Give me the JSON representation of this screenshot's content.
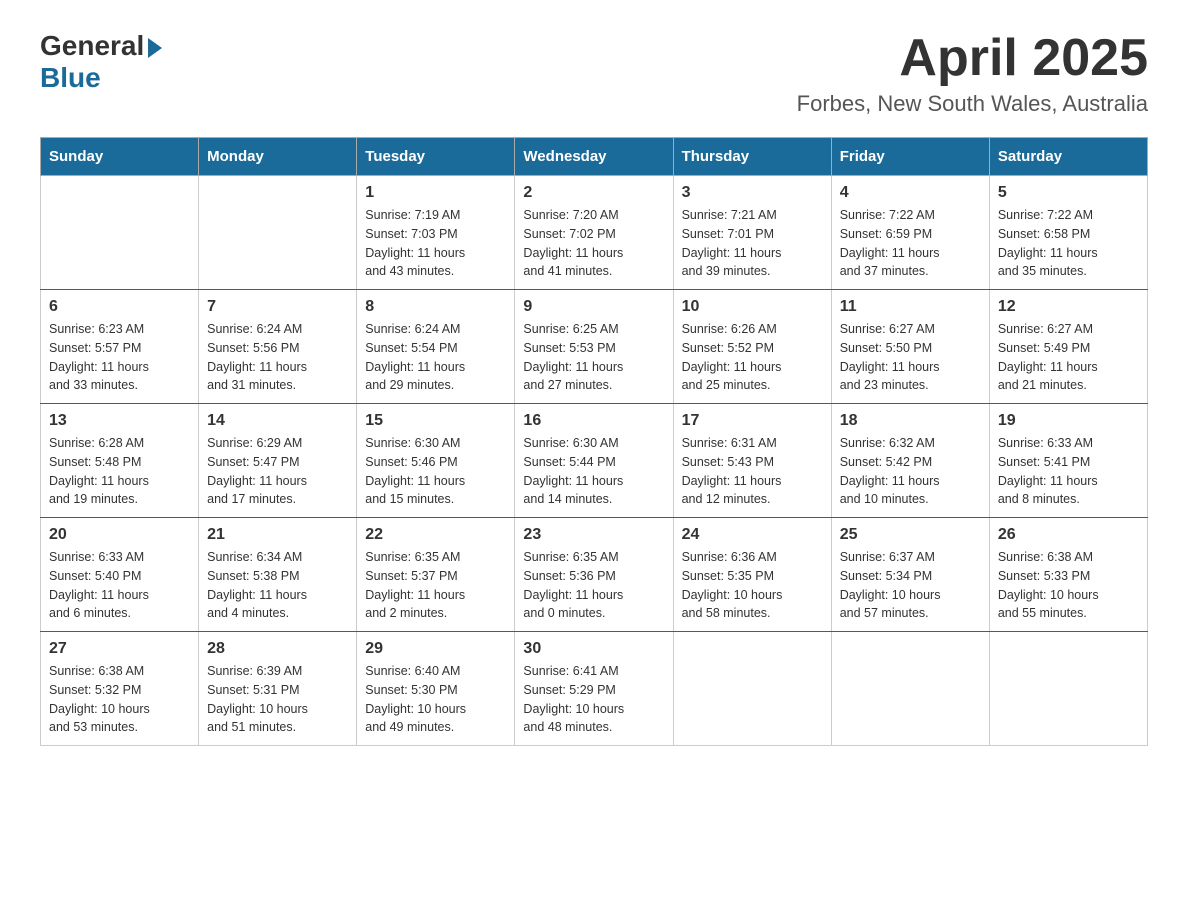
{
  "header": {
    "logo_general": "General",
    "logo_blue": "Blue",
    "title": "April 2025",
    "subtitle": "Forbes, New South Wales, Australia"
  },
  "weekdays": [
    "Sunday",
    "Monday",
    "Tuesday",
    "Wednesday",
    "Thursday",
    "Friday",
    "Saturday"
  ],
  "weeks": [
    [
      {
        "day": "",
        "info": ""
      },
      {
        "day": "",
        "info": ""
      },
      {
        "day": "1",
        "info": "Sunrise: 7:19 AM\nSunset: 7:03 PM\nDaylight: 11 hours\nand 43 minutes."
      },
      {
        "day": "2",
        "info": "Sunrise: 7:20 AM\nSunset: 7:02 PM\nDaylight: 11 hours\nand 41 minutes."
      },
      {
        "day": "3",
        "info": "Sunrise: 7:21 AM\nSunset: 7:01 PM\nDaylight: 11 hours\nand 39 minutes."
      },
      {
        "day": "4",
        "info": "Sunrise: 7:22 AM\nSunset: 6:59 PM\nDaylight: 11 hours\nand 37 minutes."
      },
      {
        "day": "5",
        "info": "Sunrise: 7:22 AM\nSunset: 6:58 PM\nDaylight: 11 hours\nand 35 minutes."
      }
    ],
    [
      {
        "day": "6",
        "info": "Sunrise: 6:23 AM\nSunset: 5:57 PM\nDaylight: 11 hours\nand 33 minutes."
      },
      {
        "day": "7",
        "info": "Sunrise: 6:24 AM\nSunset: 5:56 PM\nDaylight: 11 hours\nand 31 minutes."
      },
      {
        "day": "8",
        "info": "Sunrise: 6:24 AM\nSunset: 5:54 PM\nDaylight: 11 hours\nand 29 minutes."
      },
      {
        "day": "9",
        "info": "Sunrise: 6:25 AM\nSunset: 5:53 PM\nDaylight: 11 hours\nand 27 minutes."
      },
      {
        "day": "10",
        "info": "Sunrise: 6:26 AM\nSunset: 5:52 PM\nDaylight: 11 hours\nand 25 minutes."
      },
      {
        "day": "11",
        "info": "Sunrise: 6:27 AM\nSunset: 5:50 PM\nDaylight: 11 hours\nand 23 minutes."
      },
      {
        "day": "12",
        "info": "Sunrise: 6:27 AM\nSunset: 5:49 PM\nDaylight: 11 hours\nand 21 minutes."
      }
    ],
    [
      {
        "day": "13",
        "info": "Sunrise: 6:28 AM\nSunset: 5:48 PM\nDaylight: 11 hours\nand 19 minutes."
      },
      {
        "day": "14",
        "info": "Sunrise: 6:29 AM\nSunset: 5:47 PM\nDaylight: 11 hours\nand 17 minutes."
      },
      {
        "day": "15",
        "info": "Sunrise: 6:30 AM\nSunset: 5:46 PM\nDaylight: 11 hours\nand 15 minutes."
      },
      {
        "day": "16",
        "info": "Sunrise: 6:30 AM\nSunset: 5:44 PM\nDaylight: 11 hours\nand 14 minutes."
      },
      {
        "day": "17",
        "info": "Sunrise: 6:31 AM\nSunset: 5:43 PM\nDaylight: 11 hours\nand 12 minutes."
      },
      {
        "day": "18",
        "info": "Sunrise: 6:32 AM\nSunset: 5:42 PM\nDaylight: 11 hours\nand 10 minutes."
      },
      {
        "day": "19",
        "info": "Sunrise: 6:33 AM\nSunset: 5:41 PM\nDaylight: 11 hours\nand 8 minutes."
      }
    ],
    [
      {
        "day": "20",
        "info": "Sunrise: 6:33 AM\nSunset: 5:40 PM\nDaylight: 11 hours\nand 6 minutes."
      },
      {
        "day": "21",
        "info": "Sunrise: 6:34 AM\nSunset: 5:38 PM\nDaylight: 11 hours\nand 4 minutes."
      },
      {
        "day": "22",
        "info": "Sunrise: 6:35 AM\nSunset: 5:37 PM\nDaylight: 11 hours\nand 2 minutes."
      },
      {
        "day": "23",
        "info": "Sunrise: 6:35 AM\nSunset: 5:36 PM\nDaylight: 11 hours\nand 0 minutes."
      },
      {
        "day": "24",
        "info": "Sunrise: 6:36 AM\nSunset: 5:35 PM\nDaylight: 10 hours\nand 58 minutes."
      },
      {
        "day": "25",
        "info": "Sunrise: 6:37 AM\nSunset: 5:34 PM\nDaylight: 10 hours\nand 57 minutes."
      },
      {
        "day": "26",
        "info": "Sunrise: 6:38 AM\nSunset: 5:33 PM\nDaylight: 10 hours\nand 55 minutes."
      }
    ],
    [
      {
        "day": "27",
        "info": "Sunrise: 6:38 AM\nSunset: 5:32 PM\nDaylight: 10 hours\nand 53 minutes."
      },
      {
        "day": "28",
        "info": "Sunrise: 6:39 AM\nSunset: 5:31 PM\nDaylight: 10 hours\nand 51 minutes."
      },
      {
        "day": "29",
        "info": "Sunrise: 6:40 AM\nSunset: 5:30 PM\nDaylight: 10 hours\nand 49 minutes."
      },
      {
        "day": "30",
        "info": "Sunrise: 6:41 AM\nSunset: 5:29 PM\nDaylight: 10 hours\nand 48 minutes."
      },
      {
        "day": "",
        "info": ""
      },
      {
        "day": "",
        "info": ""
      },
      {
        "day": "",
        "info": ""
      }
    ]
  ]
}
